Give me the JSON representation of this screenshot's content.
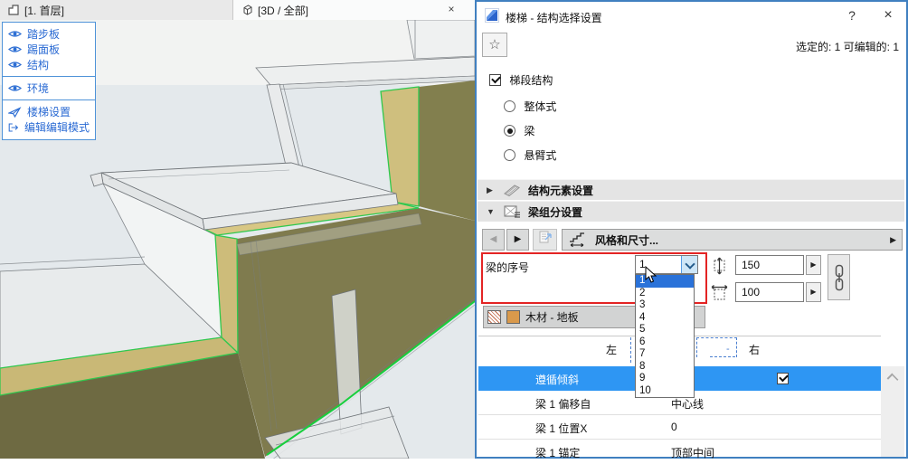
{
  "tab_bar": {
    "tabs": [
      {
        "label": "[1. 首层]"
      },
      {
        "label": "[3D / 全部]"
      }
    ],
    "close_label": "×"
  },
  "overlay_panel": {
    "items": [
      {
        "label": "踏步板"
      },
      {
        "label": "踢面板"
      },
      {
        "label": "结构"
      },
      {
        "label": "环境"
      },
      {
        "label": "楼梯设置"
      },
      {
        "label": "编辑编辑模式"
      }
    ]
  },
  "dialog": {
    "title": "楼梯 - 结构选择设置",
    "help_label": "?",
    "close_label": "×",
    "favorites_star": "☆",
    "selection_status": "选定的: 1 可编辑的: 1",
    "run_structure": {
      "label": "梯段结构",
      "checked": true
    },
    "structure_type": {
      "options": [
        {
          "label": "整体式",
          "selected": false
        },
        {
          "label": "梁",
          "selected": true
        },
        {
          "label": "悬臂式",
          "selected": false
        }
      ]
    },
    "sections": {
      "structure_elements": "结构元素设置",
      "beam_components": "梁组分设置"
    },
    "style_bar": {
      "label": "风格和尺寸..."
    },
    "beam_index": {
      "label": "梁的序号",
      "value": "1",
      "options": [
        "1",
        "2",
        "3",
        "4",
        "5",
        "6",
        "7",
        "8",
        "9",
        "10"
      ]
    },
    "beam_height": {
      "value": "150"
    },
    "beam_width": {
      "value": "100"
    },
    "material": {
      "label": "木材 - 地板"
    },
    "diagram": {
      "left_label": "左",
      "right_label": "右",
      "minus_label": "-",
      "plus_label": "+"
    },
    "table": {
      "rows": [
        {
          "label": "遵循倾斜",
          "checked": true
        },
        {
          "label": "梁 1 偏移自",
          "value": "中心线"
        },
        {
          "label": "梁 1 位置X",
          "value": "0"
        },
        {
          "label": "梁 1 锚定",
          "value": "顶部中间"
        }
      ]
    },
    "colors": {
      "accent_row_blue": "#2e96f3",
      "highlight_red": "#e32424",
      "selection_green": "#2fc84e",
      "beam_tan": "#cdbc7a",
      "beam_olive": "#7b7748"
    }
  }
}
